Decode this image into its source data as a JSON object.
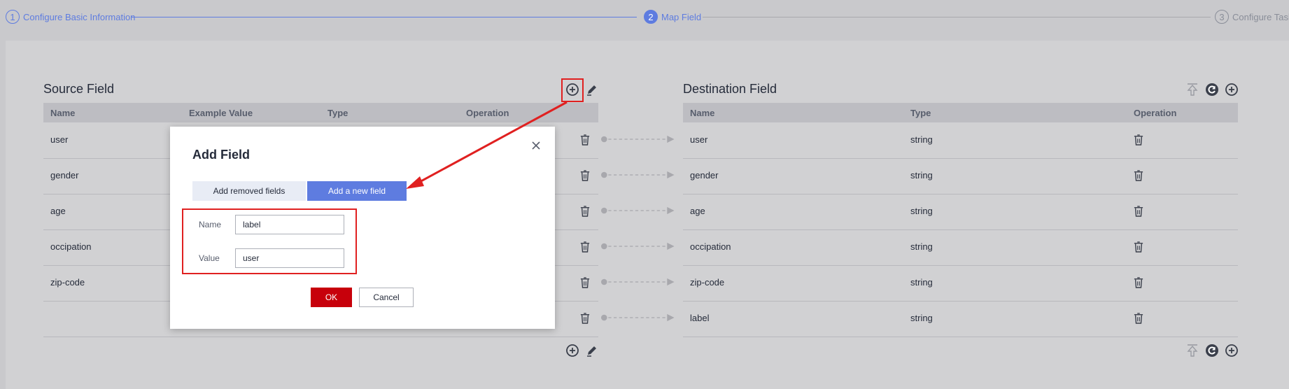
{
  "stepper": {
    "steps": [
      {
        "num": "1",
        "label": "Configure Basic Information"
      },
      {
        "num": "2",
        "label": "Map Field"
      },
      {
        "num": "3",
        "label": "Configure Task"
      }
    ]
  },
  "source": {
    "title": "Source Field",
    "columns": [
      "Name",
      "Example Value",
      "Type",
      "Operation"
    ],
    "rows": [
      "user",
      "gender",
      "age",
      "occipation",
      "zip-code",
      ""
    ]
  },
  "destination": {
    "title": "Destination Field",
    "columns": [
      "Name",
      "Type",
      "Operation"
    ],
    "rows": [
      {
        "name": "user",
        "type": "string"
      },
      {
        "name": "gender",
        "type": "string"
      },
      {
        "name": "age",
        "type": "string"
      },
      {
        "name": "occipation",
        "type": "string"
      },
      {
        "name": "zip-code",
        "type": "string"
      },
      {
        "name": "label",
        "type": "string"
      }
    ]
  },
  "modal": {
    "title": "Add Field",
    "tab_removed": "Add removed fields",
    "tab_new": "Add a new field",
    "name_label": "Name",
    "name_value": "label",
    "value_label": "Value",
    "value_value": "user",
    "ok": "OK",
    "cancel": "Cancel"
  },
  "colors": {
    "accent": "#5e7ce0",
    "danger": "#c7000b",
    "annotation": "#e02020"
  },
  "icons": [
    "plus-circle-icon",
    "edit-icon",
    "trash-icon",
    "close-icon",
    "upload-icon",
    "refresh-icon"
  ]
}
